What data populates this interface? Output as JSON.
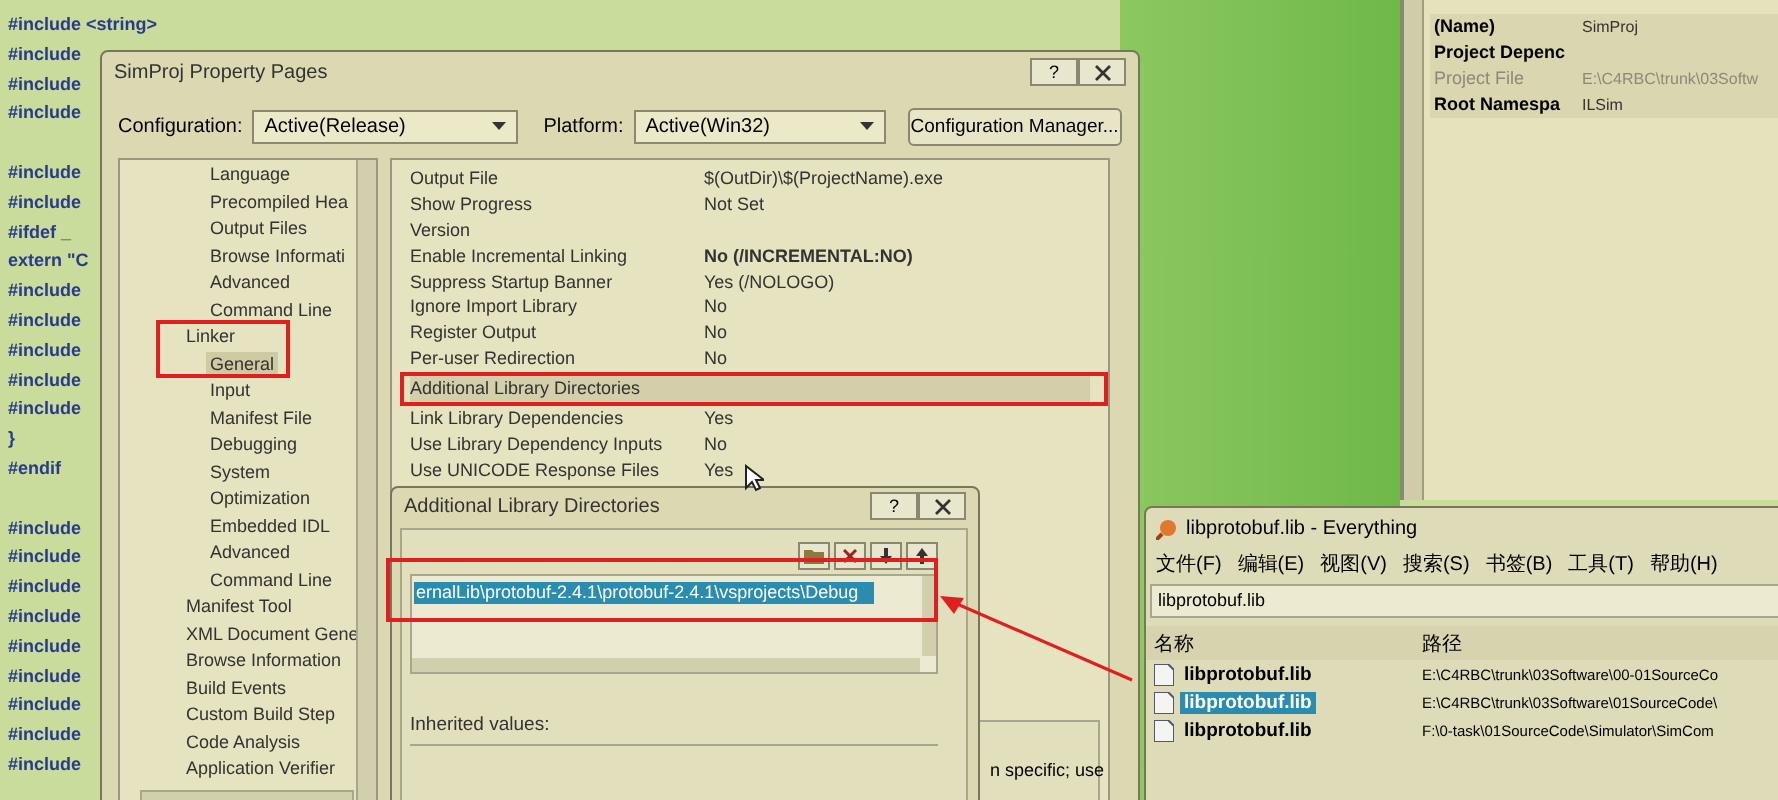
{
  "code_editor": {
    "blocks": [
      [
        "#include <string>",
        "#include",
        "#include",
        "#include"
      ],
      [
        "#include",
        "#include",
        "#ifdef _",
        "extern \"C",
        "#include",
        "#include",
        "#include",
        "#include",
        "#include",
        "}",
        "#endif"
      ],
      [
        "#include",
        "#include",
        "#include",
        "#include",
        "#include",
        "#include",
        "#include",
        "#include",
        "#include"
      ]
    ]
  },
  "property_dialog": {
    "title": "SimProj Property Pages",
    "help_button": "?",
    "configuration_label": "Configuration:",
    "configuration": "Active(Release)",
    "platform_label": "Platform:",
    "platform": "Active(Win32)",
    "config_manager_button": "Configuration Manager...",
    "tree": {
      "continued_items": [
        {
          "label": "Language",
          "selected": false
        },
        {
          "label": "Precompiled Hea",
          "selected": false
        },
        {
          "label": "Output Files",
          "selected": false
        },
        {
          "label": "Browse Informati",
          "selected": false
        },
        {
          "label": "Advanced",
          "selected": false
        },
        {
          "label": "Command Line",
          "selected": false
        }
      ],
      "items": [
        {
          "label": "Linker",
          "selected": false,
          "children": [
            {
              "label": "General",
              "selected": true
            },
            {
              "label": "Input",
              "selected": false
            },
            {
              "label": "Manifest File",
              "selected": false
            },
            {
              "label": "Debugging",
              "selected": false
            },
            {
              "label": "System",
              "selected": false
            },
            {
              "label": "Optimization",
              "selected": false
            },
            {
              "label": "Embedded IDL",
              "selected": false
            },
            {
              "label": "Advanced",
              "selected": false
            },
            {
              "label": "Command Line",
              "selected": false
            }
          ]
        },
        {
          "label": "Manifest Tool",
          "selected": false
        },
        {
          "label": "XML Document Gene",
          "selected": false
        },
        {
          "label": "Browse Information",
          "selected": false
        },
        {
          "label": "Build Events",
          "selected": false
        },
        {
          "label": "Custom Build Step",
          "selected": false
        },
        {
          "label": "Code Analysis",
          "selected": false
        },
        {
          "label": "Application Verifier",
          "selected": false
        }
      ]
    },
    "properties": [
      {
        "name": "Output File",
        "value": "$(OutDir)\\$(ProjectName).exe",
        "modified": false,
        "selected": false
      },
      {
        "name": "Show Progress",
        "value": "Not Set",
        "modified": false,
        "selected": false
      },
      {
        "name": "Version",
        "selected": false
      },
      {
        "name": "Enable Incremental Linking",
        "value": "No (/INCREMENTAL:NO)",
        "modified": true,
        "selected": false
      },
      {
        "name": "Suppress Startup Banner",
        "value": "Yes (/NOLOGO)",
        "modified": false,
        "selected": false
      },
      {
        "name": "Ignore Import Library",
        "value": "No",
        "modified": false,
        "selected": false
      },
      {
        "name": "Register Output",
        "value": "No",
        "modified": false,
        "selected": false
      },
      {
        "name": "Per-user Redirection",
        "value": "No",
        "modified": false,
        "selected": false
      },
      {
        "name": "Additional Library Directories",
        "selected": true
      },
      {
        "name": "Link Library Dependencies",
        "value": "Yes",
        "modified": false,
        "selected": false
      },
      {
        "name": "Use Library Dependency Inputs",
        "value": "No",
        "modified": false,
        "selected": false
      },
      {
        "name": "Use UNICODE Response Files",
        "value": "Yes",
        "modified": false,
        "selected": false
      }
    ],
    "description": "n specific; use"
  },
  "lib_dirs_dialog": {
    "title": "Additional Library Directories",
    "help_button": "?",
    "entries": [
      {
        "path": "ernalLib\\protobuf-2.4.1\\protobuf-2.4.1\\vsprojects\\Debug",
        "selected": true
      }
    ],
    "inherited_label": "Inherited values:"
  },
  "everything_window": {
    "title": "libprotobuf.lib - Everything",
    "menu": [
      "文件(F)",
      "编辑(E)",
      "视图(V)",
      "搜索(S)",
      "书签(B)",
      "工具(T)",
      "帮助(H)"
    ],
    "search": {
      "value": "libprotobuf.lib"
    },
    "columns": [
      "名称",
      "路径"
    ],
    "rows": [
      {
        "name": "libprotobuf.lib",
        "path": "E:\\C4RBC\\trunk\\03Software\\00-01SourceCo",
        "selected": false
      },
      {
        "name": "libprotobuf.lib",
        "path": "E:\\C4RBC\\trunk\\03Software\\01SourceCode\\",
        "selected": true
      },
      {
        "name": "libprotobuf.lib",
        "path": "F:\\0-task\\01SourceCode\\Simulator\\SimCom",
        "selected": false
      }
    ]
  },
  "solution_properties": {
    "rows": [
      {
        "name": "(Name)",
        "value": "SimProj",
        "disabled": false
      },
      {
        "name": "Project Depenc",
        "disabled": false
      },
      {
        "name": "Project File",
        "value": "E:\\C4RBC\\trunk\\03Softw",
        "disabled": true
      },
      {
        "name": "Root Namespa",
        "value": "ILSim",
        "disabled": false
      }
    ]
  }
}
